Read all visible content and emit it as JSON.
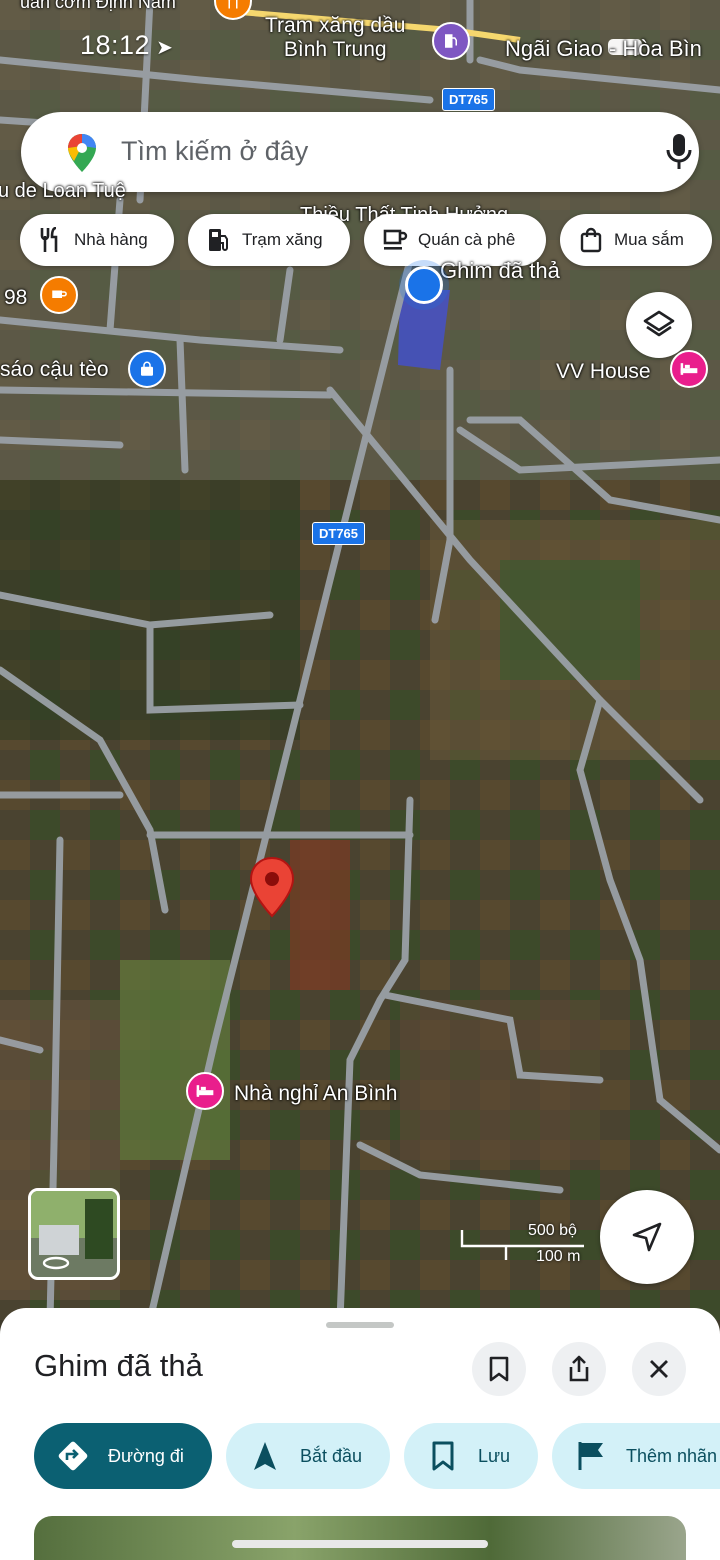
{
  "status_bar": {
    "time": "18:12"
  },
  "search": {
    "placeholder": "Tìm kiếm ở đây"
  },
  "chips": [
    {
      "label": "Nhà hàng",
      "icon": "fork-knife-icon"
    },
    {
      "label": "Trạm xăng",
      "icon": "gas-pump-icon"
    },
    {
      "label": "Quán cà phê",
      "icon": "coffee-cup-icon"
    },
    {
      "label": "Mua sắm",
      "icon": "shopping-bag-icon"
    }
  ],
  "map": {
    "labels": {
      "top_partial": "uán cơm Định Nam",
      "gas_station": "Trạm xăng dầu\nBình Trung",
      "road_top_right": "Ngãi Giao - Hòa Bìn",
      "left_partial": "u de Loan Tuệ",
      "thieu_that": "Thiều Thất Tịnh Hưởng",
      "dropped_pin": "Ghim đã thả",
      "cafe_98": "98",
      "shop_left": "sáo cậu tèo",
      "vv_house": "VV House",
      "guesthouse": "Nhà nghỉ An Bình"
    },
    "road_shields": [
      "DT765",
      "DT765"
    ],
    "scale": {
      "imperial": "500 bộ",
      "metric": "100 m"
    },
    "colors": {
      "my_location": "#1a73e8",
      "pin": "#ea4335",
      "poi_food": "#f57c00",
      "poi_shop": "#1a73e8",
      "poi_hotel": "#e91e8c"
    }
  },
  "sheet": {
    "title": "Ghim đã thả",
    "actions": [
      {
        "label": "Đường đi",
        "icon": "directions-icon"
      },
      {
        "label": "Bắt đầu",
        "icon": "navigation-arrow-icon"
      },
      {
        "label": "Lưu",
        "icon": "bookmark-icon"
      },
      {
        "label": "Thêm nhãn",
        "icon": "flag-icon"
      }
    ]
  }
}
